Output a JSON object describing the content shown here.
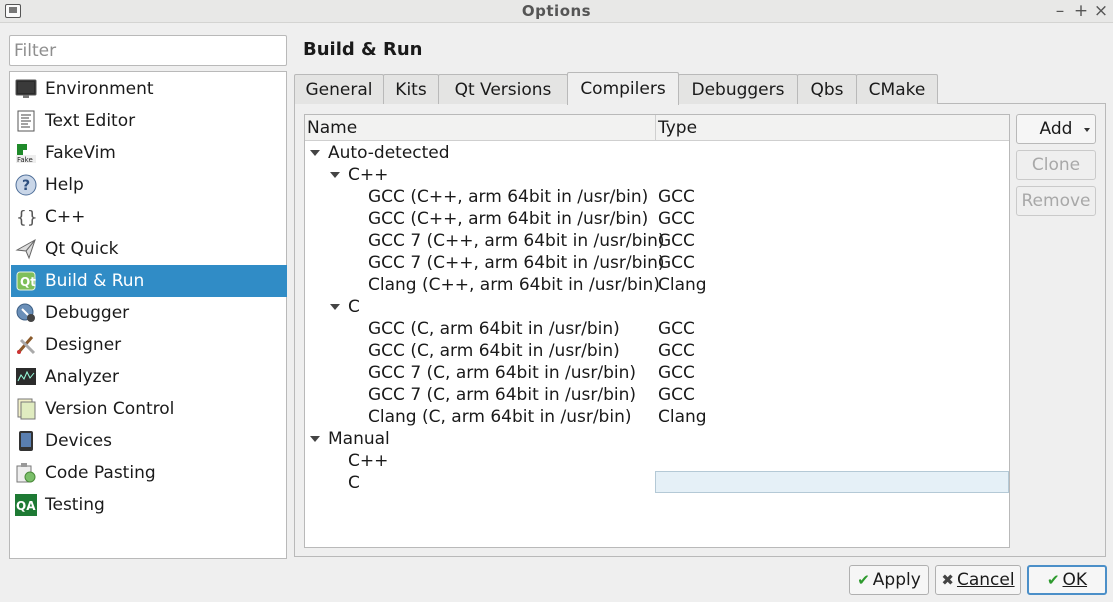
{
  "window": {
    "title": "Options"
  },
  "filter": {
    "placeholder": "Filter",
    "value": ""
  },
  "categories": [
    {
      "label": "Environment",
      "icon": "monitor-icon",
      "selected": false
    },
    {
      "label": "Text Editor",
      "icon": "text-document-icon",
      "selected": false
    },
    {
      "label": "FakeVim",
      "icon": "fakevim-icon",
      "selected": false
    },
    {
      "label": "Help",
      "icon": "help-icon",
      "selected": false
    },
    {
      "label": "C++",
      "icon": "cpp-braces-icon",
      "selected": false
    },
    {
      "label": "Qt Quick",
      "icon": "qt-quick-icon",
      "selected": false
    },
    {
      "label": "Build & Run",
      "icon": "build-run-icon",
      "selected": true
    },
    {
      "label": "Debugger",
      "icon": "debugger-icon",
      "selected": false
    },
    {
      "label": "Designer",
      "icon": "designer-icon",
      "selected": false
    },
    {
      "label": "Analyzer",
      "icon": "analyzer-icon",
      "selected": false
    },
    {
      "label": "Version Control",
      "icon": "version-control-icon",
      "selected": false
    },
    {
      "label": "Devices",
      "icon": "devices-icon",
      "selected": false
    },
    {
      "label": "Code Pasting",
      "icon": "code-pasting-icon",
      "selected": false
    },
    {
      "label": "Testing",
      "icon": "testing-qa-icon",
      "selected": false
    }
  ],
  "page": {
    "title": "Build & Run"
  },
  "tabs": [
    {
      "label": "General",
      "active": false
    },
    {
      "label": "Kits",
      "active": false
    },
    {
      "label": "Qt Versions",
      "active": false
    },
    {
      "label": "Compilers",
      "active": true
    },
    {
      "label": "Debuggers",
      "active": false
    },
    {
      "label": "Qbs",
      "active": false
    },
    {
      "label": "CMake",
      "active": false
    }
  ],
  "compilers": {
    "columns": {
      "name": "Name",
      "type": "Type"
    },
    "groups": [
      {
        "label": "Auto-detected",
        "expanded": true,
        "languages": [
          {
            "label": "C++",
            "expanded": true,
            "items": [
              {
                "name": "GCC (C++, arm 64bit in /usr/bin)",
                "type": "GCC"
              },
              {
                "name": "GCC (C++, arm 64bit in /usr/bin)",
                "type": "GCC"
              },
              {
                "name": "GCC 7 (C++, arm 64bit in /usr/bin)",
                "type": "GCC"
              },
              {
                "name": "GCC 7 (C++, arm 64bit in /usr/bin)",
                "type": "GCC"
              },
              {
                "name": "Clang (C++, arm 64bit in /usr/bin)",
                "type": "Clang"
              }
            ]
          },
          {
            "label": "C",
            "expanded": true,
            "items": [
              {
                "name": "GCC (C, arm 64bit in /usr/bin)",
                "type": "GCC"
              },
              {
                "name": "GCC (C, arm 64bit in /usr/bin)",
                "type": "GCC"
              },
              {
                "name": "GCC 7 (C, arm 64bit in /usr/bin)",
                "type": "GCC"
              },
              {
                "name": "GCC 7 (C, arm 64bit in /usr/bin)",
                "type": "GCC"
              },
              {
                "name": "Clang (C, arm 64bit in /usr/bin)",
                "type": "Clang"
              }
            ]
          }
        ]
      },
      {
        "label": "Manual",
        "expanded": true,
        "languages": [
          {
            "label": "C++",
            "expanded": false,
            "items": []
          },
          {
            "label": "C",
            "expanded": false,
            "items": []
          }
        ]
      }
    ]
  },
  "side_buttons": {
    "add": {
      "label": "Add",
      "enabled": true
    },
    "clone": {
      "label": "Clone",
      "enabled": false
    },
    "remove": {
      "label": "Remove",
      "enabled": false
    }
  },
  "dialog_buttons": {
    "apply": {
      "label": "Apply",
      "icon": "checkmark-icon"
    },
    "cancel": {
      "label": "Cancel",
      "icon": "x-icon"
    },
    "ok": {
      "label": "OK",
      "icon": "checkmark-icon"
    }
  },
  "colors": {
    "selection": "#308cc6",
    "accent_green": "#2e9a2e",
    "default_button_border": "#4b8fc8"
  }
}
